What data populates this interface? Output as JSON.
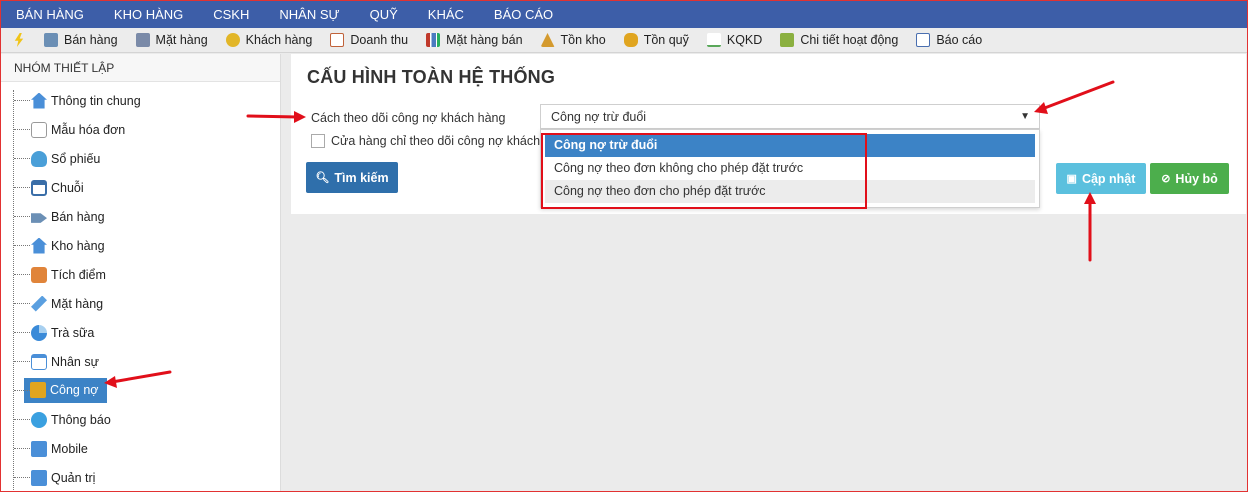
{
  "top_menu": [
    "BÁN HÀNG",
    "KHO HÀNG",
    "CSKH",
    "NHÂN SỰ",
    "QUỸ",
    "KHÁC",
    "BÁO CÁO"
  ],
  "toolbar": [
    {
      "label": "",
      "icon": "lightning-icon",
      "color": "#f0c419"
    },
    {
      "label": "Bán hàng",
      "icon": "cash-register-icon",
      "color": "#6b8fb5"
    },
    {
      "label": "Mặt hàng",
      "icon": "product-icon",
      "color": "#7a8aa8"
    },
    {
      "label": "Khách hàng",
      "icon": "customer-icon",
      "color": "#e2b628"
    },
    {
      "label": "Doanh thu",
      "icon": "revenue-icon",
      "color": "#c0623a"
    },
    {
      "label": "Mặt hàng bán",
      "icon": "bar-chart-icon",
      "color": "#4a7cc0"
    },
    {
      "label": "Tồn kho",
      "icon": "stock-icon",
      "color": "#d49a2e"
    },
    {
      "label": "Tồn quỹ",
      "icon": "coins-icon",
      "color": "#e0a520"
    },
    {
      "label": "KQKD",
      "icon": "line-chart-icon",
      "color": "#5aa85a"
    },
    {
      "label": "Chi tiết hoạt động",
      "icon": "activity-icon",
      "color": "#8bb040"
    },
    {
      "label": "Báo cáo",
      "icon": "report-icon",
      "color": "#4a6fb0"
    }
  ],
  "sidebar": {
    "title": "NHÓM THIẾT LẬP",
    "items": [
      {
        "label": "Thông tin chung",
        "icon": "home-icon",
        "color": "#4a8fd8"
      },
      {
        "label": "Mẫu hóa đơn",
        "icon": "document-icon",
        "color": "#9a9a9a"
      },
      {
        "label": "Sổ phiếu",
        "icon": "cloud-icon",
        "color": "#4a9fd8"
      },
      {
        "label": "Chuỗi",
        "icon": "network-icon",
        "color": "#3a6ea8"
      },
      {
        "label": "Bán hàng",
        "icon": "sale-tag-icon",
        "color": "#6b8fb5"
      },
      {
        "label": "Kho hàng",
        "icon": "warehouse-icon",
        "color": "#4a8fd8"
      },
      {
        "label": "Tích điểm",
        "icon": "gift-icon",
        "color": "#e0843a"
      },
      {
        "label": "Mặt hàng",
        "icon": "tag-icon",
        "color": "#5a9fe0"
      },
      {
        "label": "Trà sữa",
        "icon": "pie-icon",
        "color": "#3a8ad8"
      },
      {
        "label": "Nhân sự",
        "icon": "calendar-icon",
        "color": "#4a8fd8"
      },
      {
        "label": "Công nợ",
        "icon": "debt-coins-icon",
        "color": "#e0a520"
      },
      {
        "label": "Thông báo",
        "icon": "chat-bubble-icon",
        "color": "#3aa0e0"
      },
      {
        "label": "Mobile",
        "icon": "mobile-icon",
        "color": "#4a8fd8"
      },
      {
        "label": "Quản trị",
        "icon": "admin-icon",
        "color": "#4a8fd8"
      }
    ],
    "active_item": "Công nợ"
  },
  "main": {
    "title": "CẤU HÌNH TOÀN HỆ THỐNG",
    "debt_tracking_label": "Cách theo dõi công nợ khách hàng",
    "store_only_checkbox_label": "Cửa hàng chỉ theo dõi công nợ khách h",
    "store_only_checked": false,
    "search_button": "Tìm kiếm",
    "update_button": "Cập nhật",
    "cancel_button": "Hủy bỏ"
  },
  "debt_select": {
    "value": "Công nợ trừ đuổi",
    "options": [
      "Công nợ trừ đuổi",
      "Công nợ theo đơn không cho phép đặt trước",
      "Công nợ theo đơn cho phép đặt trước"
    ],
    "selected_index": 0,
    "hover_index": 2
  },
  "colors": {
    "top_menu_bg": "#3d5ea8",
    "primary": "#2f6fab",
    "active_item": "#3c83c6",
    "update_button": "#5bc0de",
    "cancel_button": "#4cae4c",
    "annotation_red": "#e10f1a"
  }
}
